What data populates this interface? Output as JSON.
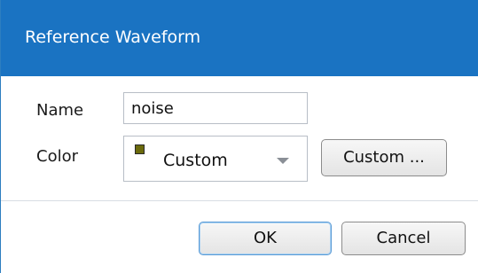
{
  "dialog": {
    "title": "Reference Waveform"
  },
  "form": {
    "name_label": "Name",
    "name_value": "noise",
    "color_label": "Color",
    "color_selected": "Custom",
    "color_swatch_hex": "#6b6a0c",
    "custom_button_label": "Custom ..."
  },
  "footer": {
    "ok_label": "OK",
    "cancel_label": "Cancel"
  },
  "colors": {
    "titlebar": "#1a73c2",
    "default_button_border": "#5b9bd5"
  }
}
